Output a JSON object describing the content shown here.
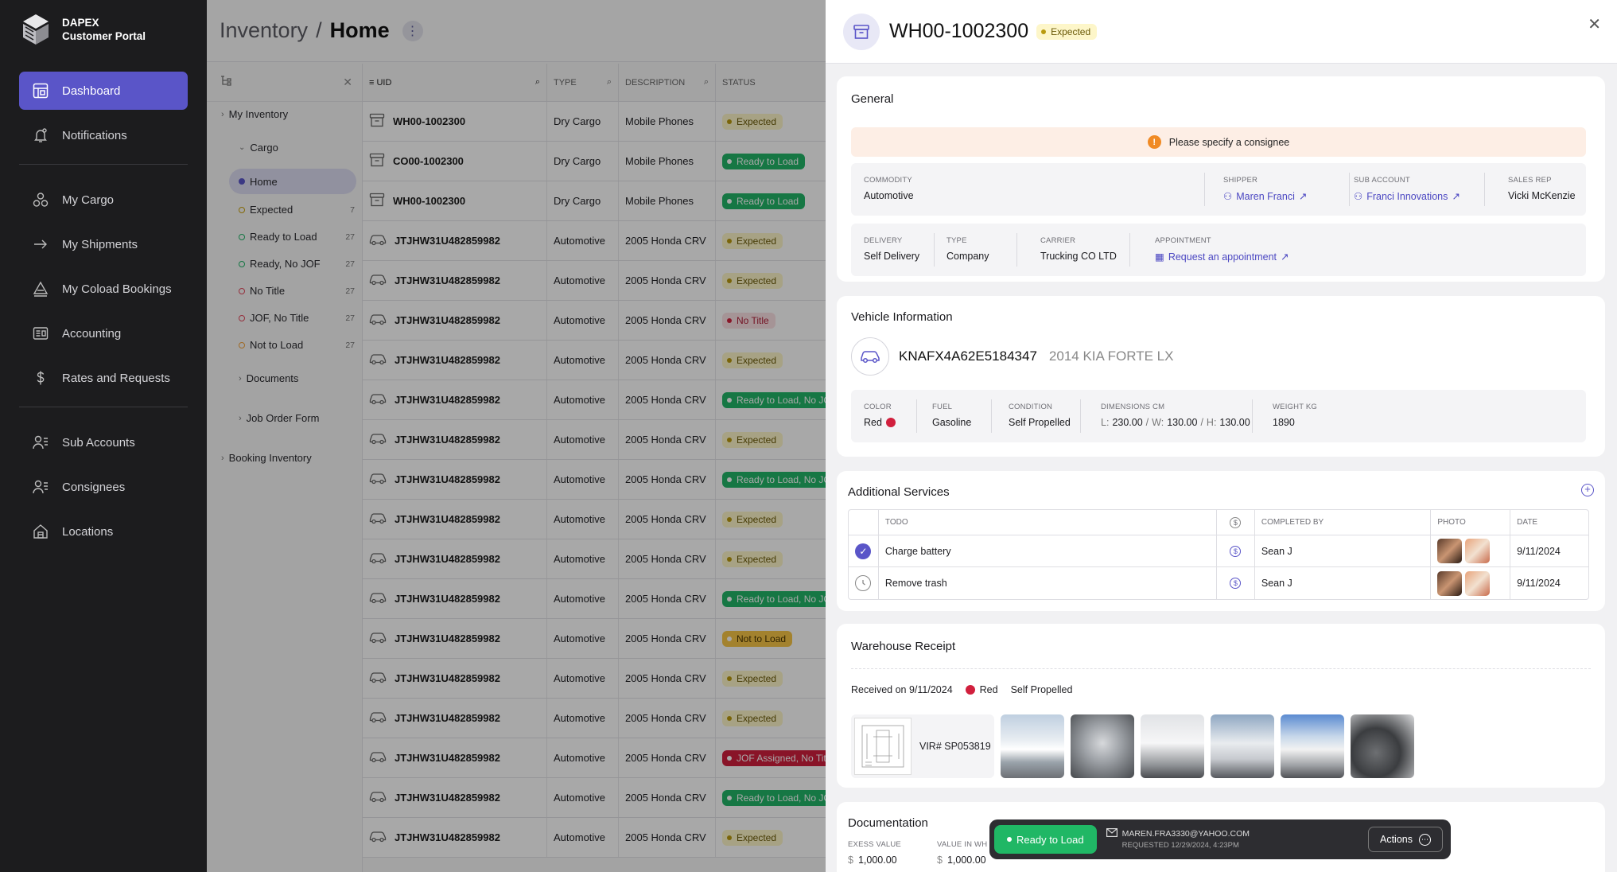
{
  "brand": {
    "line1": "DAPEX",
    "line2": "Customer Portal"
  },
  "nav": {
    "items": [
      {
        "label": "Dashboard",
        "icon": "dashboard-icon"
      },
      {
        "label": "Notifications",
        "icon": "bell-icon"
      },
      {
        "label": "My Cargo",
        "icon": "cargo-icon"
      },
      {
        "label": "My Shipments",
        "icon": "arrow-right-icon"
      },
      {
        "label": "My Coload Bookings",
        "icon": "coload-icon"
      },
      {
        "label": "Accounting",
        "icon": "accounting-icon"
      },
      {
        "label": "Rates and Requests",
        "icon": "dollar-icon"
      },
      {
        "label": "Sub Accounts",
        "icon": "sub-accounts-icon"
      },
      {
        "label": "Consignees",
        "icon": "consignees-icon"
      },
      {
        "label": "Locations",
        "icon": "locations-icon"
      }
    ]
  },
  "header": {
    "crumb1": "Inventory",
    "sep": "/",
    "crumb2": "Home"
  },
  "tree": {
    "my_inventory": "My Inventory",
    "cargo": "Cargo",
    "home": "Home",
    "items": [
      {
        "label": "Expected",
        "count": "7",
        "color": "#c8a20d"
      },
      {
        "label": "Ready to Load",
        "count": "27",
        "color": "#22b568"
      },
      {
        "label": "Ready, No JOF",
        "count": "27",
        "color": "#22b568"
      },
      {
        "label": "No Title",
        "count": "27",
        "color": "#e24a5d"
      },
      {
        "label": "JOF, No Title",
        "count": "27",
        "color": "#e24a5d"
      },
      {
        "label": "Not to Load",
        "count": "27",
        "color": "#f2a23a"
      }
    ],
    "documents": "Documents",
    "job_order_form": "Job Order Form",
    "booking_inventory": "Booking Inventory"
  },
  "table": {
    "headers": {
      "uid": "UID",
      "type": "TYPE",
      "description": "DESCRIPTION",
      "status": "STATUS"
    },
    "rows": [
      {
        "uid": "WH00-1002300",
        "icon": "box",
        "type": "Dry Cargo",
        "desc": "Mobile Phones",
        "status": "Expected",
        "kind": "exp"
      },
      {
        "uid": "CO00-1002300",
        "icon": "box",
        "type": "Dry Cargo",
        "desc": "Mobile Phones",
        "status": "Ready to Load",
        "kind": "ready"
      },
      {
        "uid": "WH00-1002300",
        "icon": "box",
        "type": "Dry Cargo",
        "desc": "Mobile Phones",
        "status": "Ready to Load",
        "kind": "ready"
      },
      {
        "uid": "JTJHW31U482859982",
        "icon": "car",
        "type": "Automotive",
        "desc": "2005 Honda CRV",
        "status": "Expected",
        "kind": "exp"
      },
      {
        "uid": "JTJHW31U482859982",
        "icon": "car",
        "type": "Automotive",
        "desc": "2005 Honda CRV",
        "status": "Expected",
        "kind": "exp"
      },
      {
        "uid": "JTJHW31U482859982",
        "icon": "car",
        "type": "Automotive",
        "desc": "2005 Honda CRV",
        "status": "No Title",
        "kind": "nt"
      },
      {
        "uid": "JTJHW31U482859982",
        "icon": "car",
        "type": "Automotive",
        "desc": "2005 Honda CRV",
        "status": "Expected",
        "kind": "exp"
      },
      {
        "uid": "JTJHW31U482859982",
        "icon": "car",
        "type": "Automotive",
        "desc": "2005 Honda CRV",
        "status": "Ready to Load, No JOF",
        "kind": "ready"
      },
      {
        "uid": "JTJHW31U482859982",
        "icon": "car",
        "type": "Automotive",
        "desc": "2005 Honda CRV",
        "status": "Expected",
        "kind": "exp"
      },
      {
        "uid": "JTJHW31U482859982",
        "icon": "car",
        "type": "Automotive",
        "desc": "2005 Honda CRV",
        "status": "Ready to Load, No JOF",
        "kind": "ready"
      },
      {
        "uid": "JTJHW31U482859982",
        "icon": "car",
        "type": "Automotive",
        "desc": "2005 Honda CRV",
        "status": "Expected",
        "kind": "exp"
      },
      {
        "uid": "JTJHW31U482859982",
        "icon": "car",
        "type": "Automotive",
        "desc": "2005 Honda CRV",
        "status": "Expected",
        "kind": "exp"
      },
      {
        "uid": "JTJHW31U482859982",
        "icon": "car",
        "type": "Automotive",
        "desc": "2005 Honda CRV",
        "status": "Ready to Load, No JOF",
        "kind": "ready"
      },
      {
        "uid": "JTJHW31U482859982",
        "icon": "car",
        "type": "Automotive",
        "desc": "2005 Honda CRV",
        "status": "Not to Load",
        "kind": "nl"
      },
      {
        "uid": "JTJHW31U482859982",
        "icon": "car",
        "type": "Automotive",
        "desc": "2005 Honda CRV",
        "status": "Expected",
        "kind": "exp"
      },
      {
        "uid": "JTJHW31U482859982",
        "icon": "car",
        "type": "Automotive",
        "desc": "2005 Honda CRV",
        "status": "Expected",
        "kind": "exp"
      },
      {
        "uid": "JTJHW31U482859982",
        "icon": "car",
        "type": "Automotive",
        "desc": "2005 Honda CRV",
        "status": "JOF Assigned, No Title",
        "kind": "jof"
      },
      {
        "uid": "JTJHW31U482859982",
        "icon": "car",
        "type": "Automotive",
        "desc": "2005 Honda CRV",
        "status": "Ready to Load, No JOF",
        "kind": "ready"
      },
      {
        "uid": "JTJHW31U482859982",
        "icon": "car",
        "type": "Automotive",
        "desc": "2005 Honda CRV",
        "status": "Expected",
        "kind": "exp"
      }
    ]
  },
  "panel": {
    "title": "WH00-1002300",
    "status": "Expected",
    "general": {
      "title": "General",
      "warning": "Please specify a consignee",
      "commodity_label": "COMMODITY",
      "commodity": "Automotive",
      "shipper_label": "SHIPPER",
      "shipper": "Maren Franci",
      "sub_account_label": "SUB ACCOUNT",
      "sub_account": "Franci Innovations",
      "sales_rep_label": "SALES REP",
      "sales_rep": "Vicki McKenzie",
      "delivery_label": "DELIVERY",
      "delivery": "Self Delivery",
      "type_label": "TYPE",
      "type": "Company",
      "carrier_label": "CARRIER",
      "carrier": "Trucking CO LTD",
      "appointment_label": "APPOINTMENT",
      "appointment": "Request an appointment"
    },
    "vehicle": {
      "title": "Vehicle Information",
      "vin": "KNAFX4A62E5184347",
      "desc": "2014 KIA FORTE LX",
      "color_label": "COLOR",
      "color": "Red",
      "color_hex": "#d11f3d",
      "fuel_label": "FUEL",
      "fuel": "Gasoline",
      "condition_label": "CONDITION",
      "condition": "Self Propelled",
      "dimensions_label": "DIMENSIONS CM",
      "dim_l_label": "L:",
      "dim_l": "230.00",
      "dim_w_label": "W:",
      "dim_w": "130.00",
      "dim_h_label": "H:",
      "dim_h": "130.00",
      "dim_sep": "/",
      "weight_label": "WEIGHT KG",
      "weight": "1890"
    },
    "services": {
      "title": "Additional Services",
      "headers": {
        "todo": "TODO",
        "completed_by": "COMPLETED BY",
        "photo": "PHOTO",
        "date": "DATE"
      },
      "rows": [
        {
          "todo": "Charge battery",
          "done": true,
          "completed_by": "Sean J",
          "date": "9/11/2024"
        },
        {
          "todo": "Remove trash",
          "done": false,
          "completed_by": "Sean J",
          "date": "9/11/2024"
        }
      ]
    },
    "receipt": {
      "title": "Warehouse Receipt",
      "received": "Received on 9/11/2024",
      "color": "Red",
      "condition": "Self Propelled",
      "vir": "VIR# SP053819"
    },
    "documentation": {
      "title": "Documentation",
      "exess_label": "EXESS VALUE",
      "exess_currency": "$",
      "exess_value": "1,000.00",
      "value_label": "VALUE IN WH",
      "value_currency": "$",
      "value_value": "1,000.00"
    }
  },
  "bottom_bar": {
    "status": "Ready to Load",
    "email": "MAREN.FRA3330@YAHOO.COM",
    "requested": "REQUESTED 12/29/2024, 4:23PM",
    "actions": "Actions"
  }
}
